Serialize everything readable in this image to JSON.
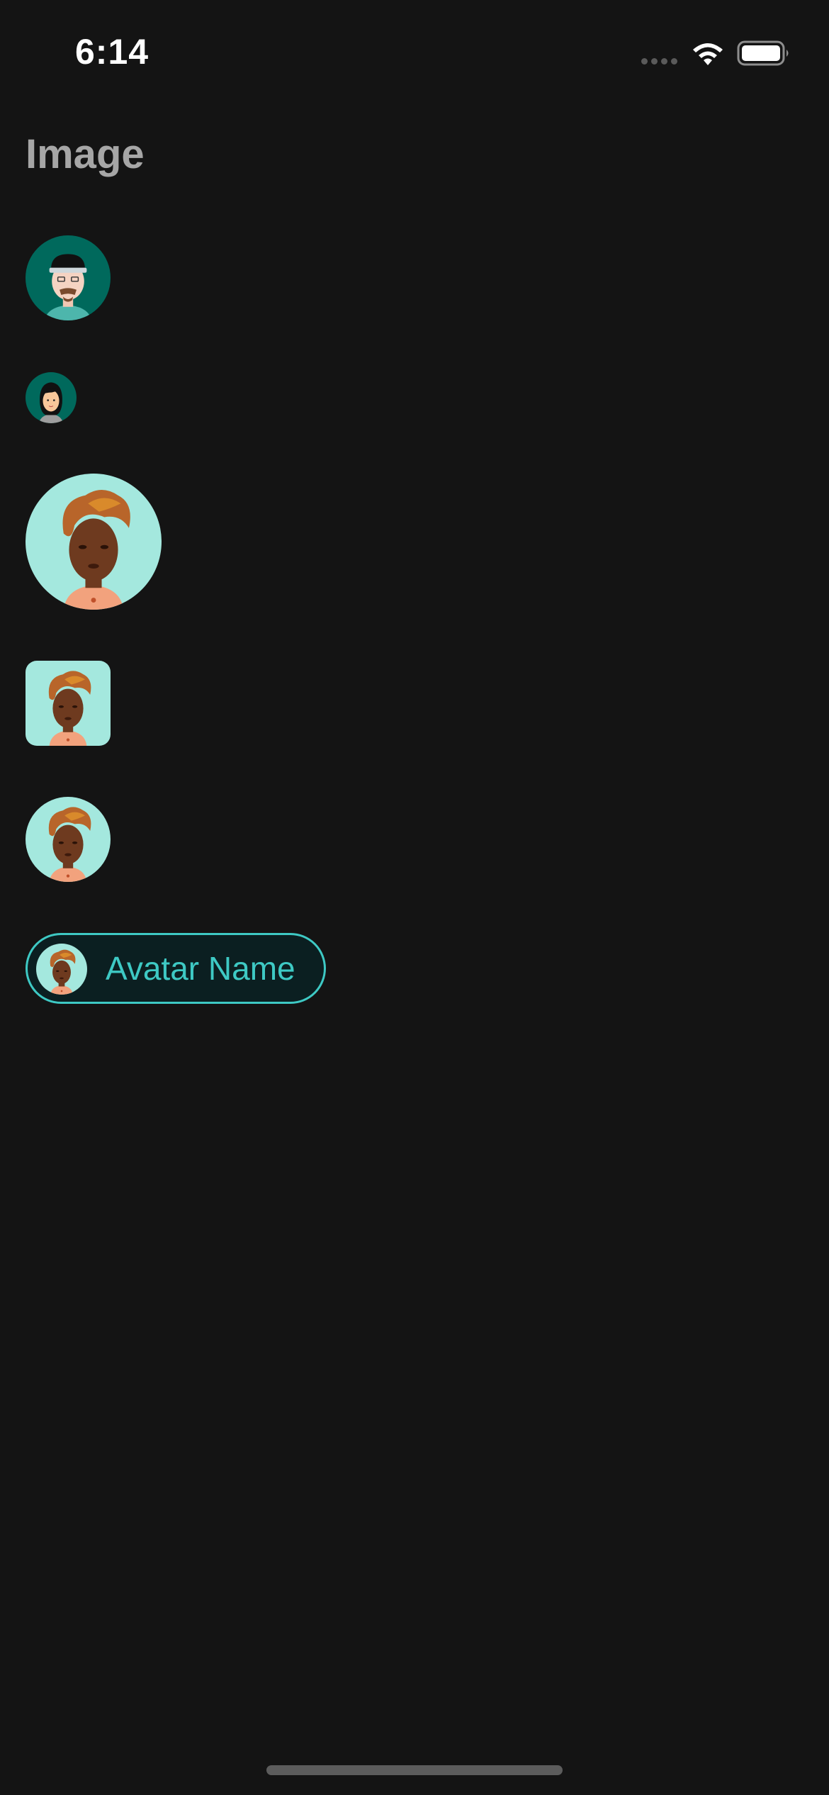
{
  "status_bar": {
    "time": "6:14",
    "icons": [
      "cellular-signal-icon",
      "wifi-icon",
      "battery-icon"
    ]
  },
  "header": {
    "title": "Image"
  },
  "avatars": [
    {
      "kind": "man-with-cap",
      "shape": "circle",
      "background": "#00695c"
    },
    {
      "kind": "woman-dark-hair",
      "shape": "circle",
      "background": "#00695c"
    },
    {
      "kind": "woman-curly-hair",
      "shape": "circle",
      "background": "#a4e8de"
    },
    {
      "kind": "woman-curly-hair",
      "shape": "rounded-square",
      "background": "#a4e8de"
    },
    {
      "kind": "woman-curly-hair",
      "shape": "circle",
      "background": "#a4e8de"
    }
  ],
  "avatar_chip": {
    "label": "Avatar Name",
    "avatar_kind": "woman-curly-hair",
    "accent": "#3ec9c4"
  },
  "colors": {
    "background": "#141414",
    "title": "#a6a6a6",
    "accent": "#3ec9c4"
  }
}
